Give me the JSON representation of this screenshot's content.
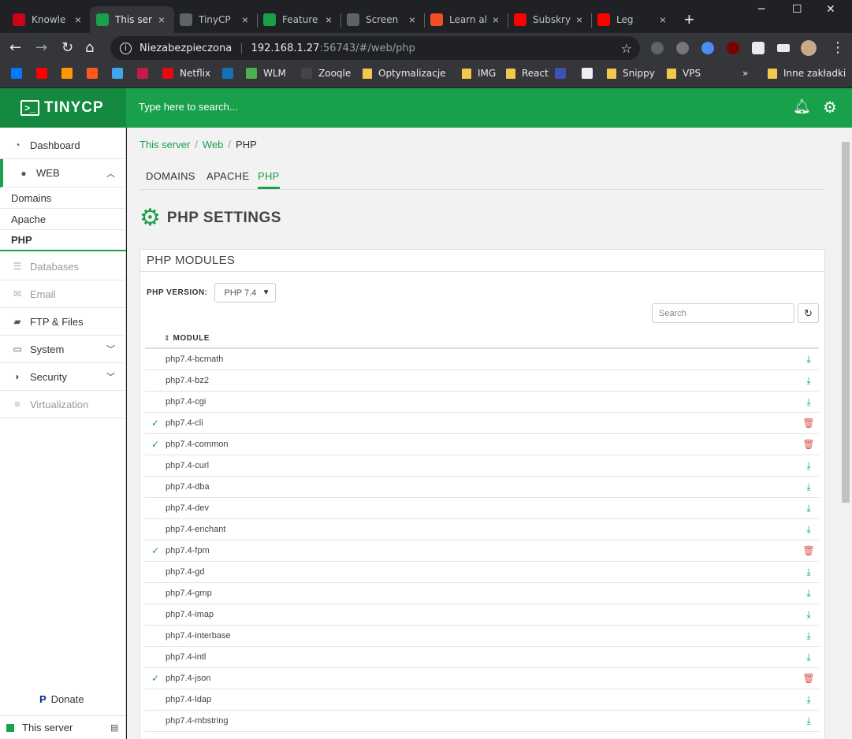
{
  "browser": {
    "tabs": [
      {
        "title": "Knowle",
        "fav_color": "#d0021b",
        "active": false
      },
      {
        "title": "This ser",
        "fav_color": "#19a04b",
        "active": true
      },
      {
        "title": "TinyCP",
        "fav_color": "#5f6368",
        "active": false
      },
      {
        "title": "Feature",
        "fav_color": "#19a04b",
        "active": false
      },
      {
        "title": "Screen",
        "fav_color": "#5f6368",
        "active": false
      },
      {
        "title": "Learn al",
        "fav_color": "#f25022",
        "active": false
      },
      {
        "title": "Subskry",
        "fav_color": "#ff0000",
        "active": false
      },
      {
        "title": "Leg",
        "fav_color": "#ff0000",
        "active": false
      }
    ],
    "address": {
      "security_label": "Niezabezpieczona",
      "host": "192.168.1.27",
      "path": ":56743/#/web/php"
    },
    "bookmarks": [
      {
        "label": "",
        "color": "#0078ff"
      },
      {
        "label": "",
        "color": "#ff0000"
      },
      {
        "label": "",
        "color": "#ff9900"
      },
      {
        "label": "",
        "color": "#ff5722"
      },
      {
        "label": "",
        "color": "#41a5ee"
      },
      {
        "label": "",
        "color": "#c51a4a"
      },
      {
        "label": "Netflix",
        "color": "#e50914"
      },
      {
        "label": "",
        "color": "#1572b6"
      },
      {
        "label": "WLM",
        "color": "#4caf50"
      },
      {
        "label": "Zooqle",
        "color": "#444444"
      },
      {
        "label": "Optymalizacje",
        "folder": true
      },
      {
        "label": "IMG",
        "folder": true
      },
      {
        "label": "React",
        "folder": true
      },
      {
        "label": "",
        "color": "#3f51b5"
      },
      {
        "label": "",
        "color": "#eeeeee"
      },
      {
        "label": "Snippy",
        "folder": true
      },
      {
        "label": "VPS",
        "folder": true
      }
    ],
    "bookmarks_overflow": "»",
    "other_bookmarks": "Inne zakładki"
  },
  "app": {
    "brand": "TINYCP",
    "search_placeholder": "Type here to search..."
  },
  "sidebar": {
    "dashboard": "Dashboard",
    "web": "WEB",
    "web_items": [
      "Domains",
      "Apache",
      "PHP"
    ],
    "databases": "Databases",
    "email": "Email",
    "ftp": "FTP & Files",
    "system": "System",
    "security": "Security",
    "virtualization": "Virtualization",
    "donate": "Donate",
    "footer": "This server"
  },
  "breadcrumb": {
    "items": [
      "This server",
      "Web",
      "PHP"
    ]
  },
  "subtabs": [
    "DOMAINS",
    "APACHE",
    "PHP"
  ],
  "page_title": "PHP SETTINGS",
  "panel": {
    "title": "PHP MODULES",
    "version_label": "PHP VERSION:",
    "version_value": "PHP 7.4",
    "search_placeholder": "Search",
    "column": "MODULE"
  },
  "modules": [
    {
      "name": "php7.4-bcmath",
      "installed": false
    },
    {
      "name": "php7.4-bz2",
      "installed": false
    },
    {
      "name": "php7.4-cgi",
      "installed": false
    },
    {
      "name": "php7.4-cli",
      "installed": true
    },
    {
      "name": "php7.4-common",
      "installed": true
    },
    {
      "name": "php7.4-curl",
      "installed": false
    },
    {
      "name": "php7.4-dba",
      "installed": false
    },
    {
      "name": "php7.4-dev",
      "installed": false
    },
    {
      "name": "php7.4-enchant",
      "installed": false
    },
    {
      "name": "php7.4-fpm",
      "installed": true
    },
    {
      "name": "php7.4-gd",
      "installed": false
    },
    {
      "name": "php7.4-gmp",
      "installed": false
    },
    {
      "name": "php7.4-imap",
      "installed": false
    },
    {
      "name": "php7.4-interbase",
      "installed": false
    },
    {
      "name": "php7.4-intl",
      "installed": false
    },
    {
      "name": "php7.4-json",
      "installed": true
    },
    {
      "name": "php7.4-ldap",
      "installed": false
    },
    {
      "name": "php7.4-mbstring",
      "installed": false
    }
  ],
  "colors": {
    "brand_green": "#19a04b",
    "danger_red": "#d9534f"
  }
}
